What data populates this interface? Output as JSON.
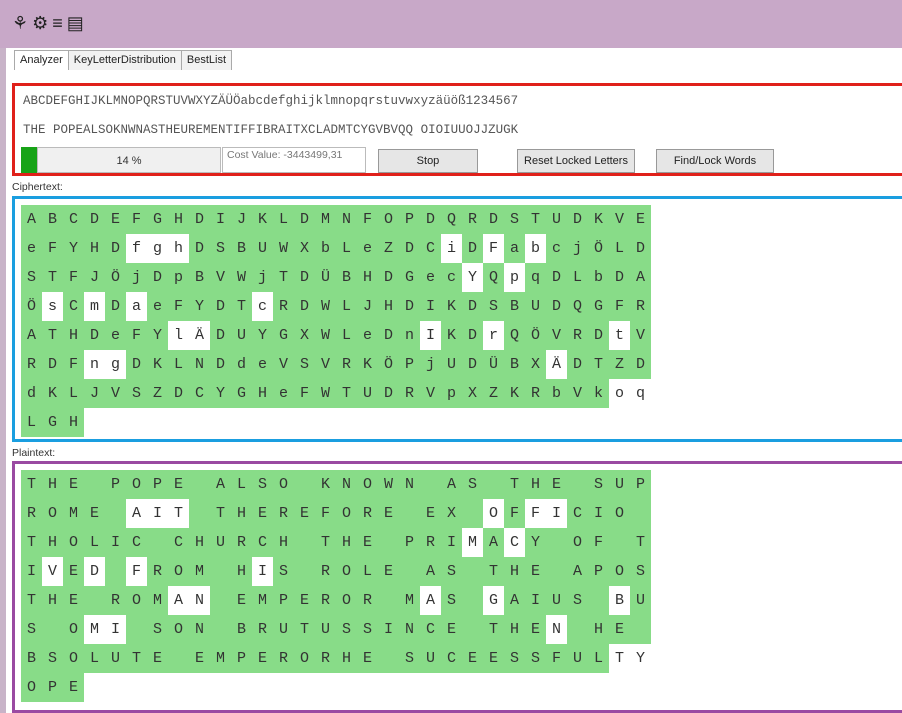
{
  "toolbar": {
    "icons": [
      "settings-group-icon",
      "gear-icon",
      "list-icon",
      "clipboard-icon"
    ]
  },
  "tabs": [
    "Analyzer",
    "KeyLetterDistribution",
    "BestList"
  ],
  "key": {
    "alphabet": "ABCDEFGHIJKLMNOPQRSTUVWXYZÄÜÖabcdefghijklmnopqrstuvwxyzäüöß1234567",
    "keyline": "THE POPEALSOKNWNASTHEUREMENTIFFIBRAITXCLADMTCYGVBVQQ OIOIUUOJJZUGK"
  },
  "controls": {
    "progress_text": "14 %",
    "progress_value": 0.14,
    "cost_label": "Cost Value: -3443499,31",
    "stop_label": "Stop",
    "reset_label": "Reset Locked Letters",
    "find_label": "Find/Lock Words",
    "accent_color": "#17a317"
  },
  "ciphertext": {
    "label": "Ciphertext:",
    "rows": [
      "ABCDEFGHDIJKLDMNFOPDQRDSTUDKVE",
      "eFYHDfghDSBUWXbLeZDCiDFabcjÖLD",
      "STFJÖjDpBVWjTDÜBHDGecYQpqDLbDA",
      "ÖsCmDaeFYDTcRDWLJHDIKDSBUDQGFR",
      "ATHDeFYlÄDUYGXWLeDnIKDrQÖVRDtV",
      "RDFngDKLNDdeVSVRKÖPjUDÜBXÄDTZD",
      "dKLJVSZDCYGHeFWTUDRVpXZKRbVkoq",
      "LGH"
    ],
    "white_cells": [
      [],
      [
        5,
        6,
        7,
        20,
        22,
        24
      ],
      [
        21,
        23
      ],
      [
        1,
        3,
        5,
        11
      ],
      [
        7,
        8,
        19,
        22,
        28
      ],
      [
        3,
        4,
        25
      ],
      [
        28,
        29
      ],
      []
    ]
  },
  "plaintext": {
    "label": "Plaintext:",
    "rows": [
      "THE POPE ALSO KNOWN AS THE SUP",
      "ROME AIT THEREFORE EX OFFICIO ",
      "THOLIC CHURCH THE PRIMACY OF T",
      "IVED FROM HIS ROLE AS THE APOS",
      "THE ROMAN EMPEROR MAS GAIUS BU",
      "S OMI SON BRUTUSSINCE THEN HE ",
      "BSOLUTE EMPERORHE SUCEESSFULTY",
      "OPE"
    ],
    "white_cells": [
      [],
      [
        5,
        6,
        7,
        22,
        24,
        25
      ],
      [
        21,
        23
      ],
      [
        1,
        3,
        5,
        11
      ],
      [
        7,
        8,
        19,
        22,
        28
      ],
      [
        3,
        4,
        25
      ],
      [
        28,
        29
      ],
      []
    ]
  }
}
